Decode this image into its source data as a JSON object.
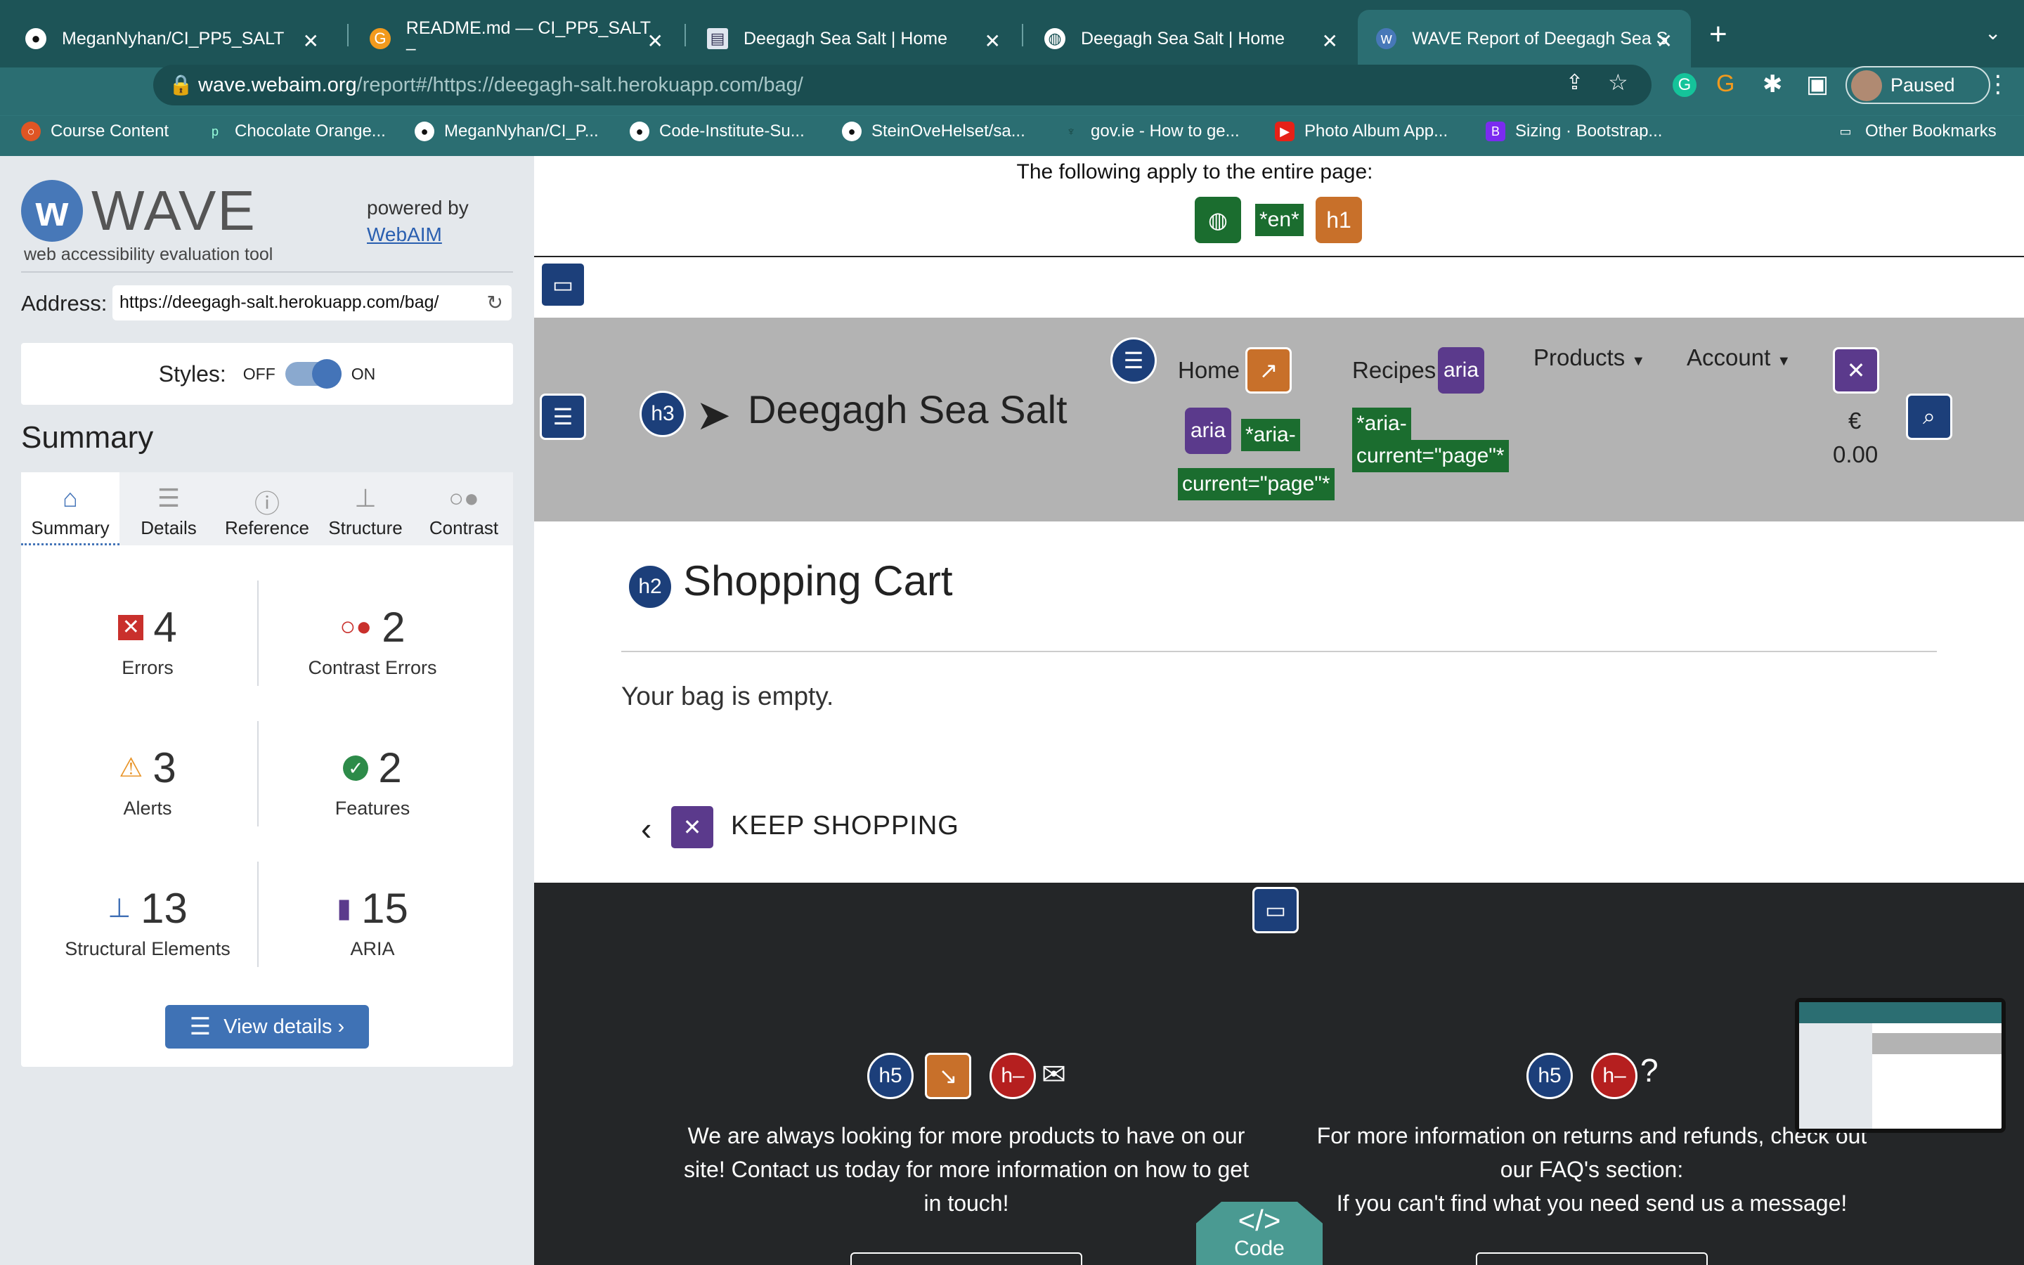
{
  "browser": {
    "tabs": [
      {
        "title": "MeganNyhan/CI_PP5_SALT",
        "icon": "github-icon"
      },
      {
        "title": "README.md — CI_PP5_SALT –",
        "icon": "gitpod-icon"
      },
      {
        "title": "Deegagh Sea Salt | Home",
        "icon": "page-icon"
      },
      {
        "title": "Deegagh Sea Salt | Home",
        "icon": "globe-icon"
      },
      {
        "title": "WAVE Report of Deegagh Sea S",
        "icon": "wave-icon"
      }
    ],
    "url_domain": "wave.webaim.org",
    "url_path": "/report#/https://deegagh-salt.herokuapp.com/bag/",
    "profile_label": "Paused",
    "bookmarks": [
      "Course Content",
      "Chocolate Orange...",
      "MeganNyhan/CI_P...",
      "Code-Institute-Su...",
      "SteinOveHelset/sa...",
      "gov.ie - How to ge...",
      "Photo Album App...",
      "Sizing · Bootstrap..."
    ],
    "other_bookmarks": "Other Bookmarks"
  },
  "wave": {
    "logo_text": "WAVE",
    "tagline": "web accessibility evaluation tool",
    "powered_by": "powered by",
    "webaim_link": "WebAIM",
    "address_label": "Address:",
    "address_value": "https://deegagh-salt.herokuapp.com/bag/",
    "styles_label": "Styles:",
    "styles_off": "OFF",
    "styles_on": "ON",
    "summary_heading": "Summary",
    "tabs": [
      "Summary",
      "Details",
      "Reference",
      "Structure",
      "Contrast"
    ],
    "stats": {
      "errors": {
        "count": "4",
        "label": "Errors"
      },
      "contrast_errors": {
        "count": "2",
        "label": "Contrast Errors"
      },
      "alerts": {
        "count": "3",
        "label": "Alerts"
      },
      "features": {
        "count": "2",
        "label": "Features"
      },
      "structural": {
        "count": "13",
        "label": "Structural Elements"
      },
      "aria": {
        "count": "15",
        "label": "ARIA"
      }
    },
    "view_details": "View details ›"
  },
  "page": {
    "apply_text": "The following apply to the entire page:",
    "lang_label": "*en*",
    "h1_label": "h1",
    "brand": "Deegagh Sea Salt",
    "nav": {
      "home": "Home",
      "recipes": "Recipes",
      "products": "Products",
      "account": "Account",
      "cart_currency": "€",
      "cart_total": "0.00"
    },
    "aria_current_a": "*aria-",
    "aria_current_b": "current=\"page\"*",
    "aria_label": "aria",
    "h2_label": "h2",
    "h3_label": "h3",
    "h5_label": "h5",
    "h_empty_label": "h–",
    "cart_heading": "Shopping Cart",
    "empty_text": "Your bag is empty.",
    "keep_shopping": "KEEP SHOPPING",
    "footer_left": [
      "We are always looking for more products to have on our",
      "site! Contact us today for more information on how to get",
      "in touch!"
    ],
    "footer_right": [
      "For more information on returns and refunds, check out",
      "our FAQ's section:",
      "If you can't find what you need send us a message!"
    ],
    "code_badge_symbol": "</>",
    "code_badge": "Code"
  }
}
